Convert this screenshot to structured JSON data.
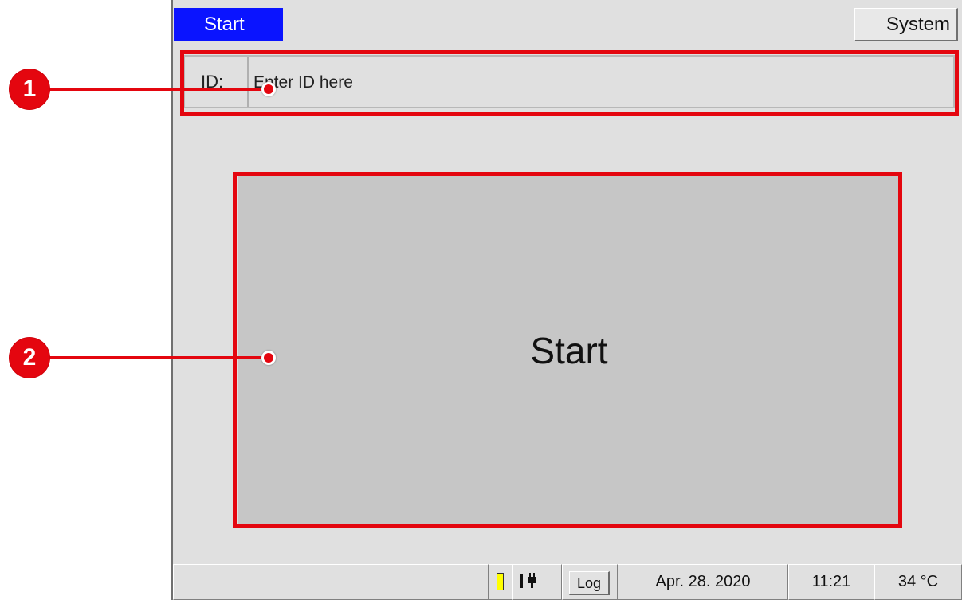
{
  "header": {
    "start_tab": "Start",
    "system_tab": "System"
  },
  "id_row": {
    "label": "ID:",
    "placeholder": "Enter ID here"
  },
  "main": {
    "start_button": "Start"
  },
  "statusbar": {
    "indicator_color": "#ffff00",
    "connection_icon": "power-plug-icon",
    "log_button": "Log",
    "date": "Apr. 28. 2020",
    "time": "11:21",
    "temperature": "34 °C"
  },
  "callouts": [
    {
      "number": "1"
    },
    {
      "number": "2"
    }
  ],
  "colors": {
    "tab_active": "#0a14ff",
    "highlight": "#e4060f",
    "screen_bg": "#e0e0e0",
    "button_bg": "#c6c6c6"
  }
}
